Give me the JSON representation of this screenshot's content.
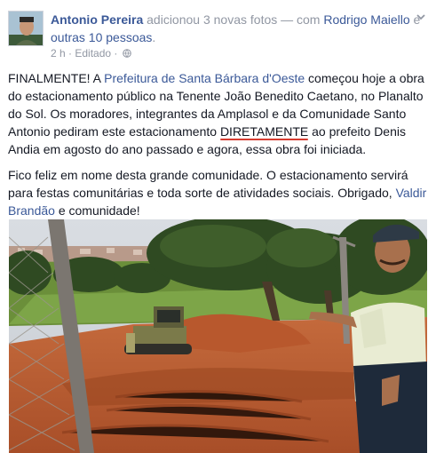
{
  "header": {
    "author": "Antonio Pereira",
    "action": " adicionou 3 novas fotos — com ",
    "tagged_person": "Rodrigo Maiello",
    "connector": " e ",
    "others": "outras 10 pessoas",
    "end": "."
  },
  "meta": {
    "time": "2 h",
    "separator": " · ",
    "edited": "Editado",
    "separator2": " · "
  },
  "icons": {
    "audience": "globe-icon",
    "menu": "chevron-down-icon"
  },
  "post": {
    "p1_start": "FINALMENTE! A ",
    "p1_link": "Prefeitura de Santa Bárbara d'Oeste",
    "p1_mid": " começou hoje a obra do estacionamento público na Tenente João Benedito Caetano, no Planalto do Sol. Os moradores, integrantes da Amplasol e da Comunidade Santo Antonio pediram este estacionamento ",
    "p1_highlight": "DIRETAMENTE",
    "p1_end": " ao prefeito Denis Andia em agosto do ano passado e agora, essa obra foi iniciada.",
    "p2_start": "Fico feliz em nome desta grande comunidade. O estacionamento servirá para festas comunitárias e toda sorte de atividades sociais. Obrigado, ",
    "p2_link": "Valdir Brandão",
    "p2_end": " e comunidade!"
  },
  "colors": {
    "link": "#3b5998",
    "meta": "#9197a3",
    "text": "#141823",
    "underline": "#d63b30"
  }
}
